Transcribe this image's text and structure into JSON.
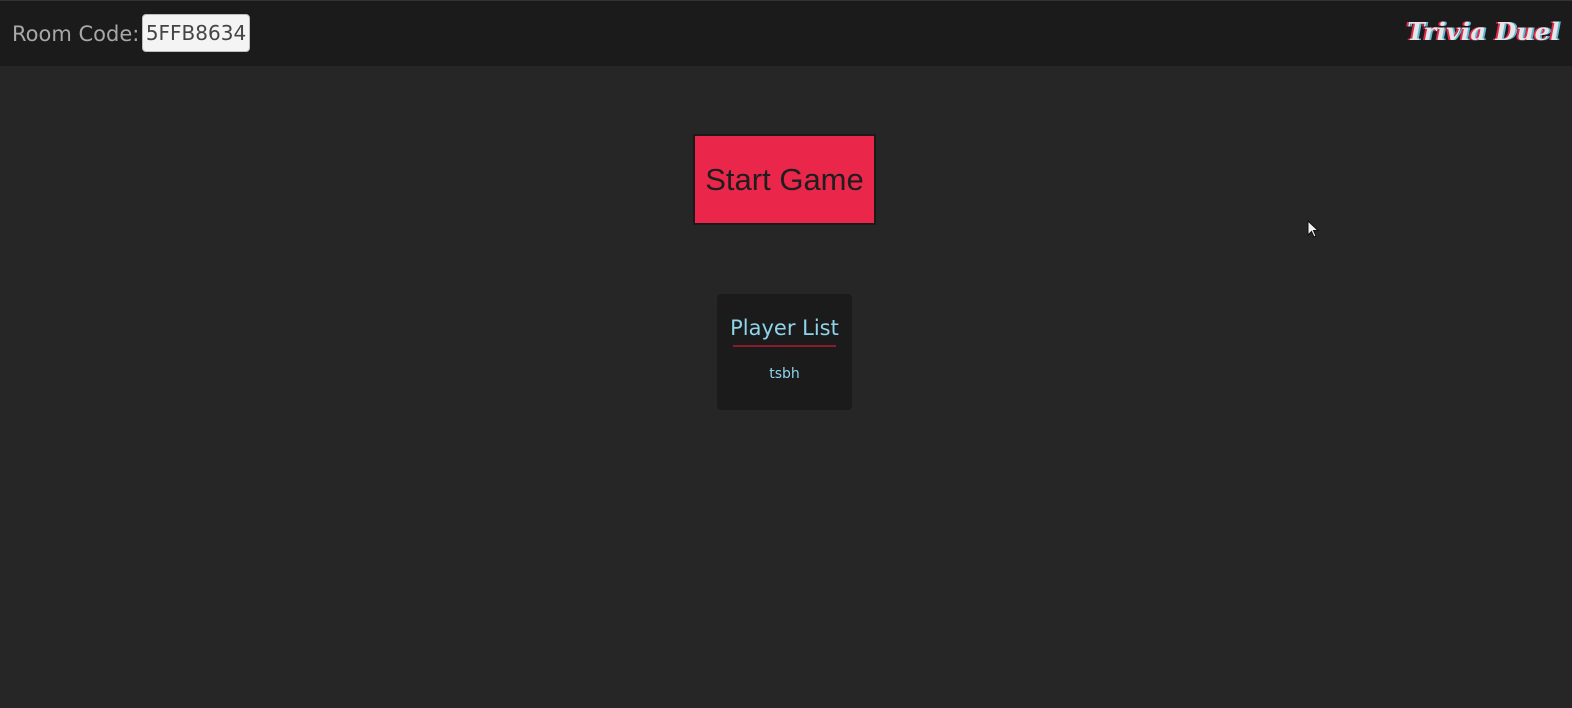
{
  "header": {
    "room_label": "Room Code:",
    "room_code": "5FFB8634",
    "logo_text": "Trivia Duel"
  },
  "main": {
    "start_button_label": "Start Game",
    "player_list": {
      "title": "Player List",
      "players": [
        "tsbh"
      ]
    }
  },
  "colors": {
    "background": "#262626",
    "header_bg": "#1b1b1b",
    "accent_red": "#ea264b",
    "accent_cyan": "#8fd3ea"
  }
}
